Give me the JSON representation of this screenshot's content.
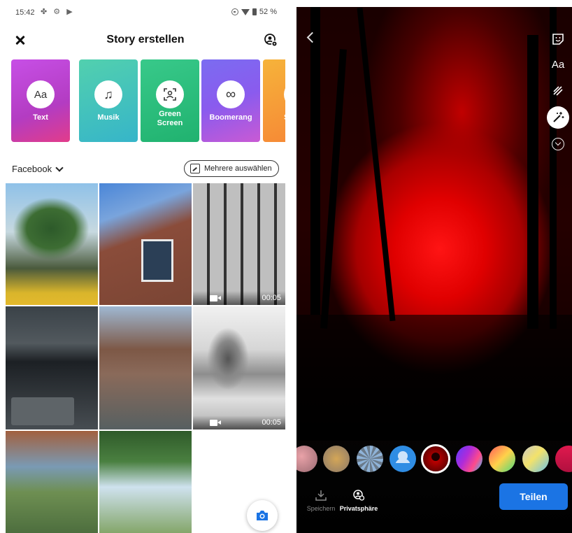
{
  "left_screen": {
    "status_bar": {
      "time": "15:42",
      "battery": "52 %"
    },
    "header": {
      "title": "Story erstellen"
    },
    "creation_cards": [
      {
        "label": "Text",
        "icon": "text-aa-icon",
        "icon_text": "Aa"
      },
      {
        "label": "Musik",
        "icon": "music-note-icon",
        "icon_text": "♫"
      },
      {
        "label": "Green\nScreen",
        "icon": "green-screen-icon",
        "icon_text": ""
      },
      {
        "label": "Boomerang",
        "icon": "infinity-icon",
        "icon_text": "∞"
      },
      {
        "label": "Se",
        "icon": "selfie-icon",
        "icon_text": ""
      }
    ],
    "source_selector": {
      "label": "Facebook"
    },
    "multi_select_button": {
      "label": "Mehrere auswählen"
    },
    "gallery": [
      {
        "name": "photo-palm-tree",
        "is_video": false
      },
      {
        "name": "photo-brick-house",
        "is_video": false
      },
      {
        "name": "video-keyboard-closeup",
        "is_video": true,
        "duration": "00:05"
      },
      {
        "name": "photo-laptop-keyboard",
        "is_video": false
      },
      {
        "name": "photo-street-collage",
        "is_video": false
      },
      {
        "name": "video-river-sketch",
        "is_video": true,
        "duration": "00:05"
      },
      {
        "name": "photo-landscape-collage",
        "is_video": false
      },
      {
        "name": "photo-trees",
        "is_video": false
      }
    ]
  },
  "right_screen": {
    "tools": {
      "text_tool": "Aa"
    },
    "bottom_actions": {
      "save_label": "Speichern",
      "privacy_label": "Privatsphäre"
    },
    "share_button": {
      "label": "Teilen"
    }
  },
  "colors": {
    "facebook_blue": "#1b74e4",
    "filter_selected_ring": "#ffffff"
  }
}
